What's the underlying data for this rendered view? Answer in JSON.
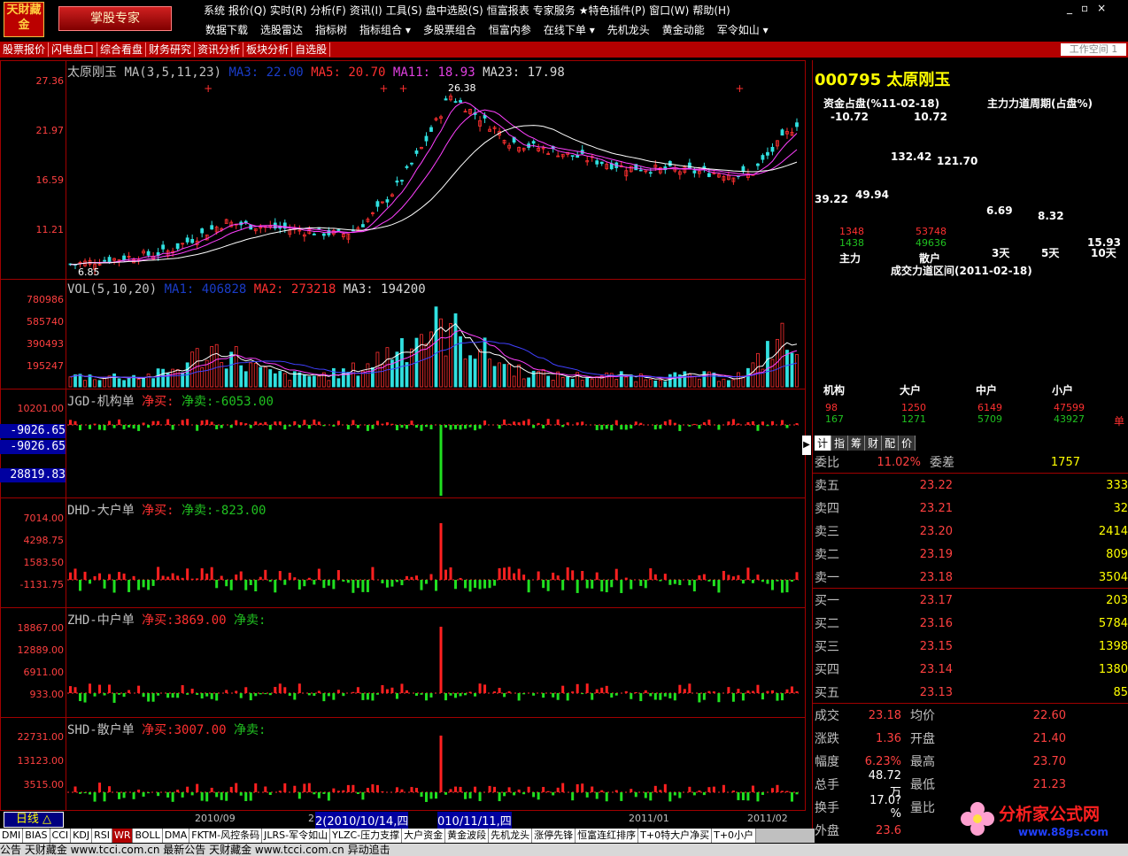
{
  "app": {
    "logo": "天財藏金",
    "title_button": "掌股专家"
  },
  "menu": [
    "系统",
    "报价(Q)",
    "实时(R)",
    "分析(F)",
    "资讯(I)",
    "工具(S)",
    "盘中选股(S)",
    "恒富报表",
    "专家服务",
    "★特色插件(P)",
    "窗口(W)",
    "帮助(H)"
  ],
  "window_controls": [
    "_",
    "▫",
    "×"
  ],
  "toolbar": [
    "数据下载",
    "选股雷达",
    "指标树",
    "指标组合 ▾",
    "多股票组合",
    "恒富内参",
    "在线下单 ▾",
    "先机龙头",
    "黄金动能",
    "军令如山 ▾"
  ],
  "nav_tabs": [
    "股票报价",
    "闪电盘口",
    "综合看盘",
    "财务研究",
    "资讯分析",
    "板块分析",
    "自选股"
  ],
  "workspace": "工作空间 1",
  "main_panel": {
    "stock_name": "太原刚玉",
    "ma_label": "MA(3,5,11,23)",
    "ma3": "MA3: 22.00",
    "ma5": "MA5: 20.70",
    "ma11": "MA11: 18.93",
    "ma23": "MA23: 17.98",
    "y_ticks": [
      "27.36",
      "21.97",
      "16.59",
      "11.21"
    ],
    "high_label": "26.38",
    "low_label": "6.85"
  },
  "vol_panel": {
    "label": "VOL(5,10,20)",
    "ma1": "MA1: 406828",
    "ma2": "MA2: 273218",
    "ma3": "MA3: 194200",
    "y_ticks": [
      "780986",
      "585740",
      "390493",
      "195247"
    ]
  },
  "jgd_panel": {
    "label": "JGD-机构单",
    "buy": "净买:",
    "sell": "净卖:-6053.00",
    "y_ticks": [
      "10201.00"
    ],
    "box1": "-9026.65",
    "box2": "-9026.65",
    "box3": "28819.83"
  },
  "dhd_panel": {
    "label": "DHD-大户单",
    "buy": "净买:",
    "sell": "净卖:-823.00",
    "y_ticks": [
      "7014.00",
      "4298.75",
      "1583.50",
      "-1131.75"
    ]
  },
  "zhd_panel": {
    "label": "ZHD-中户单",
    "buy": "净买:3869.00",
    "sell": "净卖:",
    "y_ticks": [
      "18867.00",
      "12889.00",
      "6911.00",
      "933.00"
    ]
  },
  "shd_panel": {
    "label": "SHD-散户单",
    "buy": "净买:3007.00",
    "sell": "净卖:",
    "y_ticks": [
      "22731.00",
      "13123.00",
      "3515.00"
    ]
  },
  "x_axis": {
    "labels": [
      "2010/09",
      "2",
      "2(2010/10/14,四",
      "010/11/11,四",
      "2011/01",
      "2011/02"
    ],
    "day_button": "日线 △"
  },
  "indicator_tabs": [
    "DMI",
    "BIAS",
    "CCI",
    "KDJ",
    "RSI",
    "WR",
    "BOLL",
    "DMA",
    "FKTM-风控条码",
    "JLRS-军令如山",
    "YLZC-压力支撑",
    "大户资金",
    "黄金波段",
    "先机龙头",
    "涨停先锋",
    "恒富连红排序",
    "T+0特大户净买",
    "T+0小户"
  ],
  "statusbar": "公告 天财藏金 www.tcci.com.cn    最新公告 天财藏金 www.tcci.com.cn      异动追击",
  "right_panel": {
    "code": "000795",
    "name": "太原刚玉",
    "fund_title": "资金占盘(%11-02-18)",
    "force_title": "主力力道周期(占盘%)",
    "fund_vals": [
      "-10.72",
      "10.72",
      "132.42",
      "121.70",
      "39.22",
      "49.94"
    ],
    "fund_counts": [
      "1348",
      "1438",
      "53748",
      "49636"
    ],
    "fund_labels": [
      "主力",
      "散户"
    ],
    "force_vals": [
      "6.69",
      "8.32",
      "15.93"
    ],
    "force_labels": [
      "3天",
      "5天",
      "10天"
    ],
    "trade_title": "成交力道区间(2011-02-18)",
    "trade_labels": [
      "机构",
      "大户",
      "中户",
      "小户"
    ],
    "trade_red": [
      "98",
      "1250",
      "6149",
      "47599"
    ],
    "trade_grn": [
      "167",
      "1271",
      "5709",
      "43927"
    ],
    "trade_unit": "单",
    "tabs": [
      "计",
      "指",
      "筹",
      "财",
      "配",
      "价"
    ],
    "quote_top": {
      "k1": "委比",
      "v1": "11.02%",
      "k2": "委差",
      "v2": "1757"
    },
    "sell": [
      {
        "k": "卖五",
        "p": "23.22",
        "v": "333"
      },
      {
        "k": "卖四",
        "p": "23.21",
        "v": "32"
      },
      {
        "k": "卖三",
        "p": "23.20",
        "v": "2414"
      },
      {
        "k": "卖二",
        "p": "23.19",
        "v": "809"
      },
      {
        "k": "卖一",
        "p": "23.18",
        "v": "3504"
      }
    ],
    "buy": [
      {
        "k": "买一",
        "p": "23.17",
        "v": "203"
      },
      {
        "k": "买二",
        "p": "23.16",
        "v": "5784"
      },
      {
        "k": "买三",
        "p": "23.15",
        "v": "1398"
      },
      {
        "k": "买四",
        "p": "23.14",
        "v": "1380"
      },
      {
        "k": "买五",
        "p": "23.13",
        "v": "85"
      }
    ],
    "stats": [
      {
        "k": "成交",
        "v": "23.18",
        "k2": "均价",
        "v2": "22.60"
      },
      {
        "k": "涨跌",
        "v": "1.36",
        "k2": "开盘",
        "v2": "21.40"
      },
      {
        "k": "幅度",
        "v": "6.23%",
        "k2": "最高",
        "v2": "23.70"
      },
      {
        "k": "总手",
        "v": "48.72万",
        "k2": "最低",
        "v2": "21.23"
      },
      {
        "k": "换手",
        "v": "17.0?%",
        "k2": "量比",
        "v2": ""
      },
      {
        "k": "外盘",
        "v": "23.6",
        "k2": "",
        "v2": ""
      }
    ]
  },
  "watermark": {
    "text": "分析家公式网",
    "url": "www.88gs.com"
  }
}
